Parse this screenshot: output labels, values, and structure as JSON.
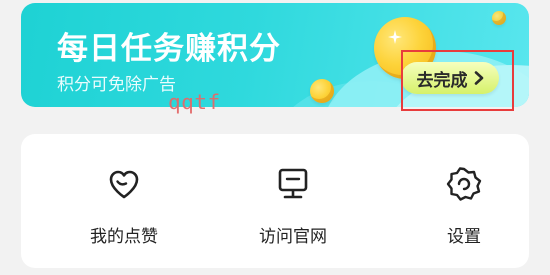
{
  "banner": {
    "title": "每日任务赚积分",
    "subtitle": "积分可免除广告",
    "cta_label": "去完成",
    "cta_icon": "chevron-right-icon",
    "colors": {
      "gradient_start": "#1ed2d4",
      "gradient_end": "#59e6ee",
      "cta_background": "#e6f77d",
      "highlight_border": "#e83c3c"
    }
  },
  "watermark": {
    "text": "qqtf"
  },
  "menu": {
    "items": [
      {
        "label": "我的点赞",
        "icon": "heart-icon"
      },
      {
        "label": "访问官网",
        "icon": "monitor-icon"
      },
      {
        "label": "设置",
        "icon": "gear-icon"
      }
    ]
  }
}
